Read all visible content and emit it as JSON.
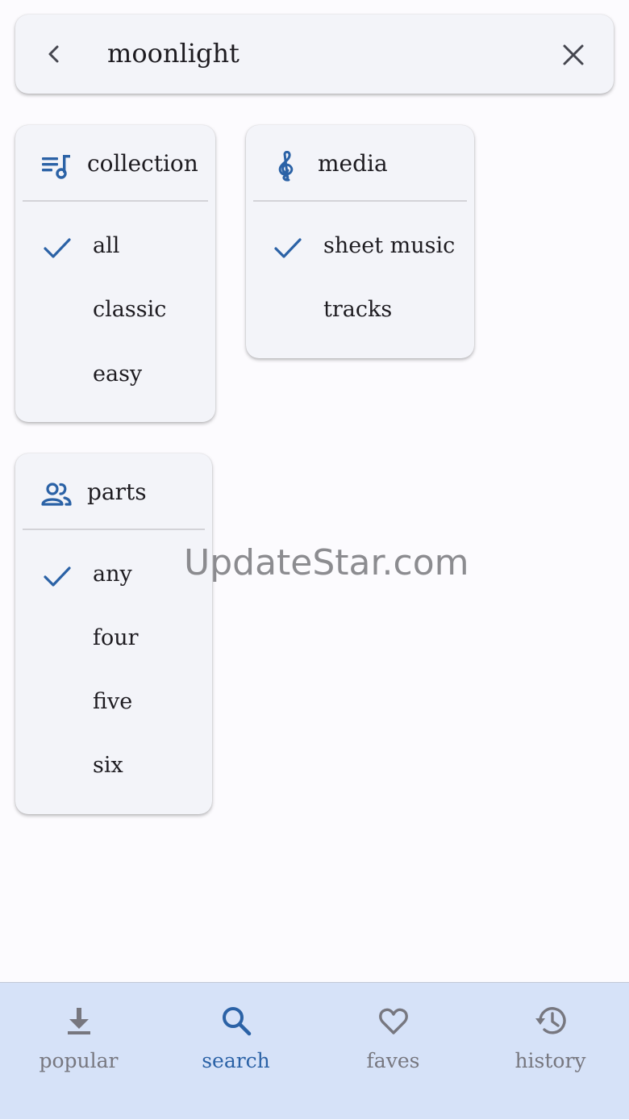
{
  "search": {
    "query": "moonlight",
    "back_icon": "chevron-left-icon",
    "clear_icon": "close-icon"
  },
  "filters": {
    "collection": {
      "title": "collection",
      "icon": "playlist-music-icon",
      "options": [
        {
          "label": "all",
          "selected": true
        },
        {
          "label": "classic",
          "selected": false
        },
        {
          "label": "easy",
          "selected": false
        }
      ]
    },
    "media": {
      "title": "media",
      "icon": "treble-clef-icon",
      "options": [
        {
          "label": "sheet music",
          "selected": true
        },
        {
          "label": "tracks",
          "selected": false
        }
      ]
    },
    "parts": {
      "title": "parts",
      "icon": "people-icon",
      "options": [
        {
          "label": "any",
          "selected": true
        },
        {
          "label": "four",
          "selected": false
        },
        {
          "label": "five",
          "selected": false
        },
        {
          "label": "six",
          "selected": false
        }
      ]
    }
  },
  "watermark": "UpdateStar.com",
  "bottom_nav": {
    "items": [
      {
        "label": "popular",
        "icon": "download-icon",
        "active": false
      },
      {
        "label": "search",
        "icon": "search-icon",
        "active": true
      },
      {
        "label": "faves",
        "icon": "heart-icon",
        "active": false
      },
      {
        "label": "history",
        "icon": "history-icon",
        "active": false
      }
    ]
  },
  "colors": {
    "accent": "#2b62a6",
    "icon_inactive": "#77777f",
    "nav_background": "#d6e2f8",
    "card_background": "#f3f4f9"
  }
}
